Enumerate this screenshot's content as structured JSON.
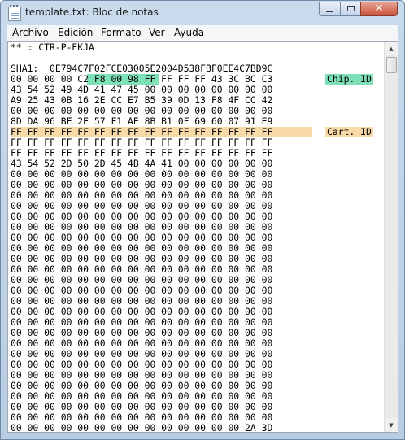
{
  "window": {
    "title": "template.txt: Bloc de notas",
    "icons": {
      "app": "notepad-icon",
      "minimize": "minimize-icon",
      "maximize": "maximize-icon",
      "close": "close-icon"
    },
    "close_glyph": "✕"
  },
  "menu": [
    "Archivo",
    "Edición",
    "Formato",
    "Ver",
    "Ayuda"
  ],
  "document": {
    "lines": [
      "** : CTR-P-EKJA",
      "",
      "SHA1:  0E794C7F02FCE03005E2004D538FBF0EE4C7BD9C",
      "00 00 00 00 C2 F8 00 98 FF FF FF FF 43 3C BC C3",
      "43 54 52 49 4D 41 47 45 00 00 00 00 00 00 00 00",
      "A9 25 43 0B 16 2E CC E7 B5 39 0D 13 F8 4F CC 42",
      "00 00 00 00 00 00 00 00 00 00 00 00 00 00 00 00",
      "8D DA 96 BF 2E 57 F1 AE 8B B1 0F 69 60 07 91 E9",
      "FF FF FF FF FF FF FF FF FF FF FF FF FF FF FF FF",
      "FF FF FF FF FF FF FF FF FF FF FF FF FF FF FF FF",
      "FF FF FF FF FF FF FF FF FF FF FF FF FF FF FF FF",
      "43 54 52 2D 50 2D 45 4B 4A 41 00 00 00 00 00 00",
      "00 00 00 00 00 00 00 00 00 00 00 00 00 00 00 00",
      "00 00 00 00 00 00 00 00 00 00 00 00 00 00 00 00",
      "00 00 00 00 00 00 00 00 00 00 00 00 00 00 00 00",
      "00 00 00 00 00 00 00 00 00 00 00 00 00 00 00 00",
      "00 00 00 00 00 00 00 00 00 00 00 00 00 00 00 00",
      "00 00 00 00 00 00 00 00 00 00 00 00 00 00 00 00",
      "00 00 00 00 00 00 00 00 00 00 00 00 00 00 00 00",
      "00 00 00 00 00 00 00 00 00 00 00 00 00 00 00 00",
      "00 00 00 00 00 00 00 00 00 00 00 00 00 00 00 00",
      "00 00 00 00 00 00 00 00 00 00 00 00 00 00 00 00",
      "00 00 00 00 00 00 00 00 00 00 00 00 00 00 00 00",
      "00 00 00 00 00 00 00 00 00 00 00 00 00 00 00 00",
      "00 00 00 00 00 00 00 00 00 00 00 00 00 00 00 00",
      "00 00 00 00 00 00 00 00 00 00 00 00 00 00 00 00",
      "00 00 00 00 00 00 00 00 00 00 00 00 00 00 00 00",
      "00 00 00 00 00 00 00 00 00 00 00 00 00 00 00 00",
      "00 00 00 00 00 00 00 00 00 00 00 00 00 00 00 00",
      "00 00 00 00 00 00 00 00 00 00 00 00 00 00 00 00",
      "00 00 00 00 00 00 00 00 00 00 00 00 00 00 00 00",
      "00 00 00 00 00 00 00 00 00 00 00 00 00 00 00 00",
      "00 00 00 00 00 00 00 00 00 00 00 00 00 00 00 00",
      "00 00 00 00 00 00 00 00 00 00 00 00 00 00 00 00",
      "00 00 00 00 00 00 00 00 00 00 00 00 00 00 00 00",
      "00 00 00 00 00 00 00 00 00 00 00 00 00 00 00 00",
      "00 00 00 00 00 00 00 00 00 00 00 00 00 00 2A 3D"
    ],
    "annotations": [
      {
        "label": "Chip. ID",
        "line": 3,
        "color": "#7ee0b6"
      },
      {
        "label": "Cart. ID",
        "line": 8,
        "color": "#f8d9a8"
      }
    ],
    "highlights": [
      {
        "line": 3,
        "from_byte": 4,
        "to_byte": 7,
        "color": "#7ee0b6"
      },
      {
        "line": 8,
        "from_byte": 0,
        "to_byte": 15,
        "color": "#f8d9a8"
      }
    ]
  }
}
